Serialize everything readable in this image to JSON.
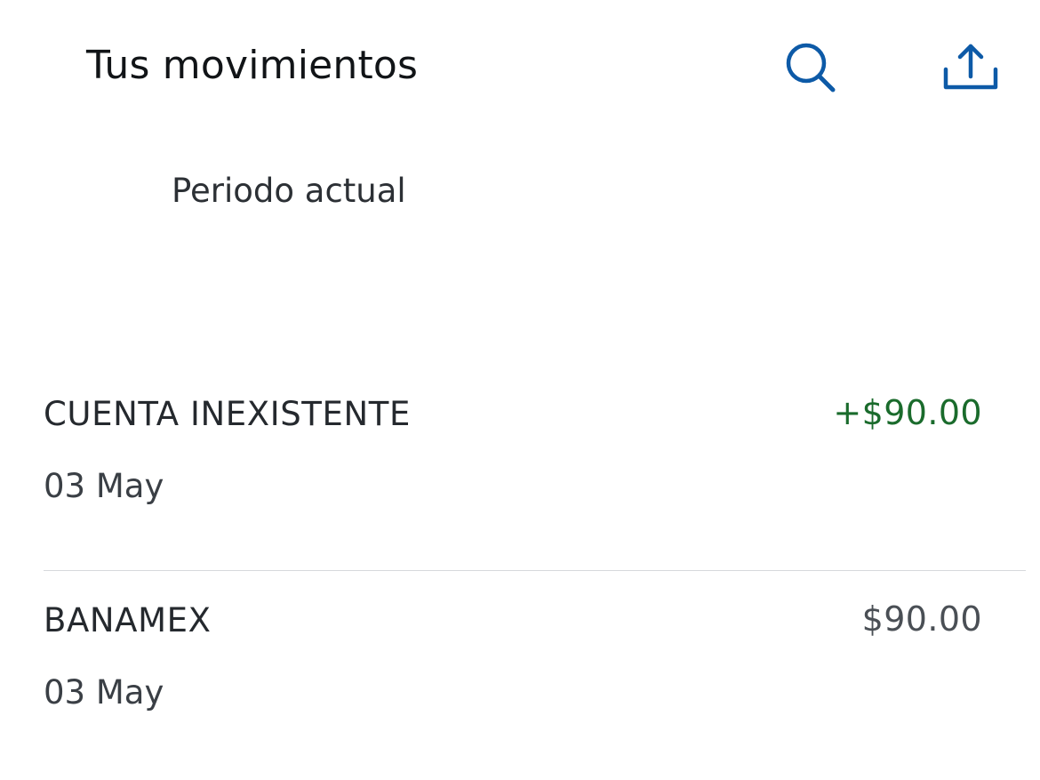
{
  "header": {
    "title": "Tus movimientos",
    "search_icon": "search-icon",
    "share_icon": "share-upload-icon"
  },
  "period": {
    "current_label": "Periodo actual",
    "other_label": ""
  },
  "colors": {
    "accent_blue": "#0d5aa7",
    "credit_green": "#1a6b2c",
    "amount_gray": "#4a4f55"
  },
  "transactions": [
    {
      "name": "CUENTA INEXISTENTE",
      "date": "03 May",
      "amount": "+$90.00",
      "type": "credit",
      "amount_color": "#1a6b2c"
    },
    {
      "name": "BANAMEX",
      "date": "03 May",
      "amount": "$90.00",
      "type": "debit",
      "amount_color": "#4a4f55"
    }
  ]
}
